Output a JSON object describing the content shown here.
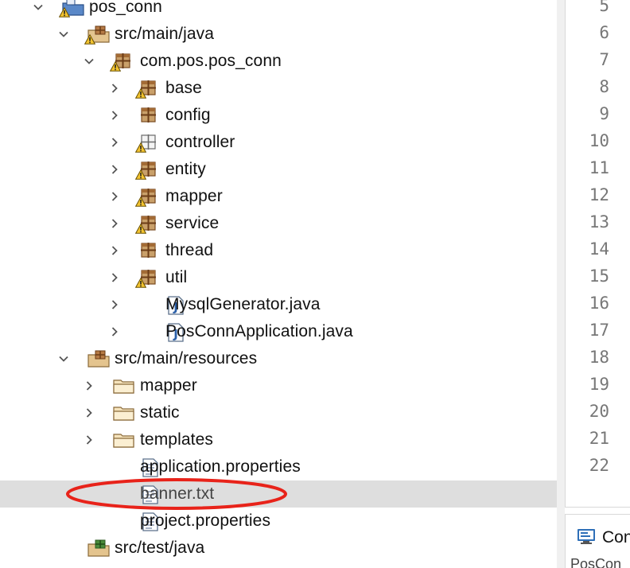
{
  "explorer": {
    "items": [
      {
        "label": "pos_conn",
        "icon": "java-project-icon",
        "expander": "expanded",
        "warning": true
      },
      {
        "label": "src/main/java",
        "icon": "source-folder-icon",
        "expander": "expanded",
        "warning": true
      },
      {
        "label": "com.pos.pos_conn",
        "icon": "package-icon",
        "expander": "expanded",
        "warning": true
      },
      {
        "label": "base",
        "icon": "package-icon",
        "expander": "collapsed",
        "warning": true
      },
      {
        "label": "config",
        "icon": "package-icon",
        "expander": "collapsed",
        "warning": false
      },
      {
        "label": "controller",
        "icon": "empty-package-icon",
        "expander": "collapsed",
        "warning": true
      },
      {
        "label": "entity",
        "icon": "package-icon",
        "expander": "collapsed",
        "warning": true
      },
      {
        "label": "mapper",
        "icon": "package-icon",
        "expander": "collapsed",
        "warning": true
      },
      {
        "label": "service",
        "icon": "package-icon",
        "expander": "collapsed",
        "warning": true
      },
      {
        "label": "thread",
        "icon": "package-icon",
        "expander": "collapsed",
        "warning": false
      },
      {
        "label": "util",
        "icon": "package-icon",
        "expander": "collapsed",
        "warning": true
      },
      {
        "label": "MysqlGenerator.java",
        "icon": "java-file-icon",
        "expander": "collapsed",
        "warning": false
      },
      {
        "label": "PosConnApplication.java",
        "icon": "java-file-icon",
        "expander": "collapsed",
        "warning": false
      },
      {
        "label": "src/main/resources",
        "icon": "source-folder-icon",
        "expander": "expanded",
        "warning": false
      },
      {
        "label": "mapper",
        "icon": "folder-icon",
        "expander": "collapsed",
        "warning": false
      },
      {
        "label": "static",
        "icon": "folder-icon",
        "expander": "collapsed",
        "warning": false
      },
      {
        "label": "templates",
        "icon": "folder-icon",
        "expander": "collapsed",
        "warning": false
      },
      {
        "label": "application.properties",
        "icon": "text-file-icon",
        "expander": "none",
        "warning": false
      },
      {
        "label": "banner.txt",
        "icon": "text-file-icon",
        "expander": "none",
        "warning": false,
        "selected": true,
        "annotated": true
      },
      {
        "label": "project.properties",
        "icon": "text-file-icon",
        "expander": "none",
        "warning": false
      },
      {
        "label": "src/test/java",
        "icon": "test-source-folder-icon",
        "expander": "none",
        "warning": false
      }
    ],
    "highlight_color": "#e8231a",
    "selection_color": "#dedede"
  },
  "editor": {
    "line_numbers": [
      "5",
      "6",
      "7",
      "8",
      "9",
      "10",
      "11",
      "12",
      "13",
      "14",
      "15",
      "16",
      "17",
      "18",
      "19",
      "20",
      "21",
      "22"
    ]
  },
  "console": {
    "tab_label": "Con",
    "sub_label": "PosCon"
  }
}
